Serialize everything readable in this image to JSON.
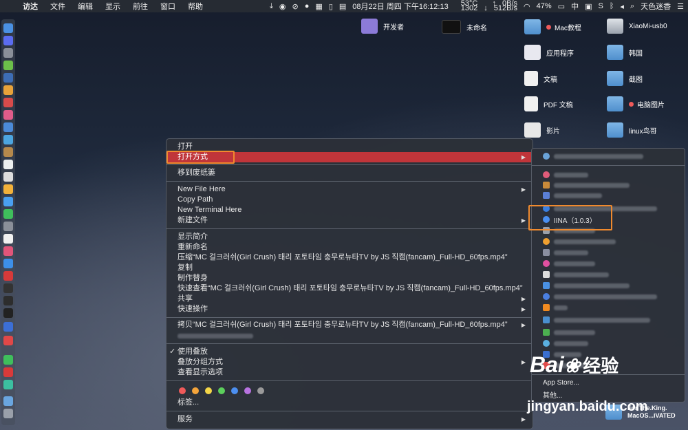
{
  "menubar": {
    "app": "访达",
    "items": [
      "文件",
      "编辑",
      "显示",
      "前往",
      "窗口",
      "帮助"
    ],
    "temp": "53°C",
    "temp_sub": "1302",
    "net_up": "0B/s",
    "net_down": "512B/s",
    "datetime": "08月22日 周四 下午16:12:13",
    "battery": "47%",
    "input": "中",
    "user": "天色迷香"
  },
  "desktop": {
    "dev": "开发者",
    "untitled": "未命名",
    "mac_tutorial": "Mac教程",
    "xiaomi": "XiaoMi-usb0",
    "apps": "应用程序",
    "korea": "韩国",
    "docs": "文稿",
    "screenshots": "截图",
    "pdf": "PDF 文稿",
    "pics": "电脑图片",
    "movies": "影片",
    "linux": "linux鸟哥",
    "bottom_name1": "For.The.King.",
    "bottom_name2": "MacOS...iVATED"
  },
  "context_menu": {
    "open": "打开",
    "open_with": "打开方式",
    "trash": "移到废纸篓",
    "new_file_here": "New File Here",
    "copy_path": "Copy Path",
    "new_terminal": "New Terminal Here",
    "new_file": "新建文件",
    "get_info": "显示简介",
    "rename": "重新命名",
    "compress": "压缩“MC 걸크러쉬(Girl Crush) 태리 포토타임 충무로뉴타TV by JS 직캠(fancam)_Full-HD_60fps.mp4”",
    "duplicate": "复制",
    "alias": "制作替身",
    "quicklook": "快速查看“MC 걸크러쉬(Girl Crush) 태리 포토타임 충무로뉴타TV by JS 직캠(fancam)_Full-HD_60fps.mp4”",
    "share": "共享",
    "quick_actions": "快速操作",
    "copy_item": "拷贝“MC 걸크러쉬(Girl Crush) 태리 포토타임 충무로뉴타TV by JS 직캠(fancam)_Full-HD_60fps.mp4”",
    "use_stacks": "使用叠放",
    "group_stacks": "叠放分组方式",
    "view_options": "查看显示选项",
    "tags": "标签...",
    "services": "服务",
    "tag_colors": [
      "#ef5a5a",
      "#f3a43b",
      "#f4d648",
      "#5cd05c",
      "#4c8ff0",
      "#b873e0",
      "#9a9a9a"
    ]
  },
  "submenu": {
    "iina": "IINA（1.0.3）",
    "app_store": "App Store...",
    "other": "其他..."
  },
  "watermark": {
    "logo": "Bai",
    "logo2": "经验",
    "url": "jingyan.baidu.com"
  }
}
